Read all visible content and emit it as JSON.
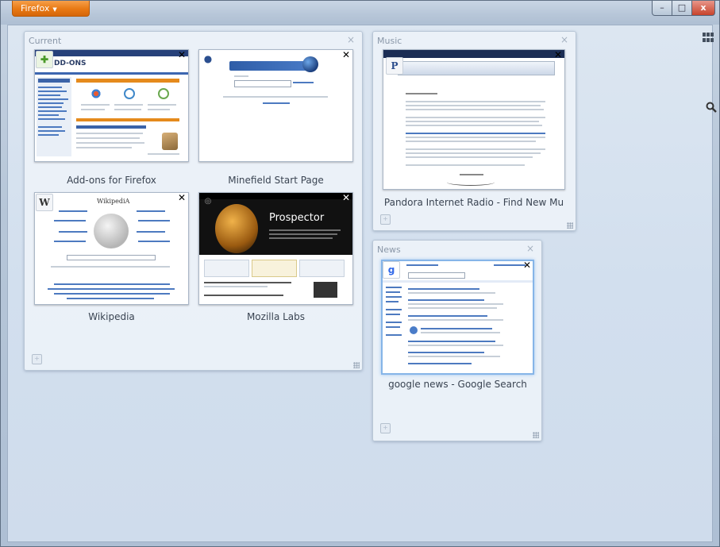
{
  "app": {
    "menu_button_label": "Firefox",
    "window_controls": {
      "minimize": "–",
      "maximize": "□",
      "close": "x"
    }
  },
  "toolbar_icons": [
    "groups-icon",
    "search-icon"
  ],
  "groups": [
    {
      "title": "Current",
      "tabs": [
        {
          "title": "Add-ons for Firefox",
          "favicon": "puzzle-icon"
        },
        {
          "title": "Minefield Start Page",
          "favicon": "globe-icon"
        },
        {
          "title": "Wikipedia",
          "favicon": "W"
        },
        {
          "title": "Mozilla Labs",
          "favicon": "labs-icon"
        }
      ]
    },
    {
      "title": "Music",
      "tabs": [
        {
          "title": "Pandora Internet Radio - Find New Mu",
          "favicon": "P"
        }
      ]
    },
    {
      "title": "News",
      "tabs": [
        {
          "title": "google news - Google Search",
          "favicon": "google-icon"
        }
      ]
    }
  ],
  "thumbnail_text": {
    "addons_heading": "DD-ONS",
    "prospector_heading": "Prospector",
    "wikipedia_heading": "WikipediA"
  },
  "colors": {
    "firefox_orange": "#e87813",
    "canvas": "#d2dfee",
    "active_tab_border": "#86b5e8"
  }
}
